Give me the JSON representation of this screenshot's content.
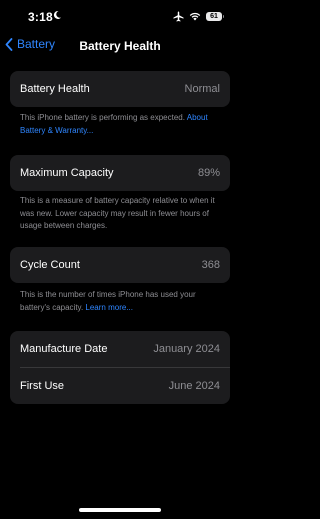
{
  "status_bar": {
    "time": "3:18",
    "battery_level": "61"
  },
  "nav": {
    "back_label": "Battery",
    "title": "Battery Health"
  },
  "battery_health": {
    "label": "Battery Health",
    "value": "Normal",
    "note": "This iPhone battery is performing as expected. ",
    "note_link": "About Battery & Warranty..."
  },
  "max_capacity": {
    "label": "Maximum Capacity",
    "value": "89%",
    "note": "This is a measure of battery capacity relative to when it was new. Lower capacity may result in fewer hours of usage between charges."
  },
  "cycle_count": {
    "label": "Cycle Count",
    "value": "368",
    "note": "This is the number of times iPhone has used your battery's capacity. ",
    "note_link": "Learn more..."
  },
  "dates": {
    "manufacture_label": "Manufacture Date",
    "manufacture_value": "January 2024",
    "first_use_label": "First Use",
    "first_use_value": "June 2024"
  },
  "colors": {
    "background": "#000000",
    "card": "#1c1c1e",
    "accent": "#2f86ff",
    "secondary_text": "#8e8e93"
  }
}
